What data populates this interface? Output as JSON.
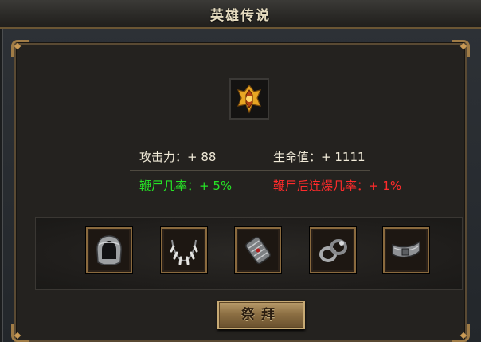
{
  "window": {
    "title": "英雄传说"
  },
  "emblem": {
    "icon": "golden-crest-icon"
  },
  "stats": {
    "attack": {
      "label": "攻击力：",
      "value": "+ 88"
    },
    "hp": {
      "label": "生命值：",
      "value": "+ 1111"
    },
    "whip_rate": {
      "label": "鞭尸几率：",
      "value": "+ 5%"
    },
    "whip_explode_rate": {
      "label": "鞭尸后连爆几率：",
      "value": "+ 1%"
    }
  },
  "equipment": [
    {
      "icon": "helmet-icon"
    },
    {
      "icon": "necklace-icon"
    },
    {
      "icon": "bracer-icon"
    },
    {
      "icon": "ring-icon"
    },
    {
      "icon": "belt-icon"
    }
  ],
  "actions": {
    "worship_label": "祭拜"
  },
  "colors": {
    "gold_border": "#a07c46",
    "green_text": "#26e326",
    "red_text": "#ff2b2b",
    "stat_text": "#f0ead8"
  }
}
